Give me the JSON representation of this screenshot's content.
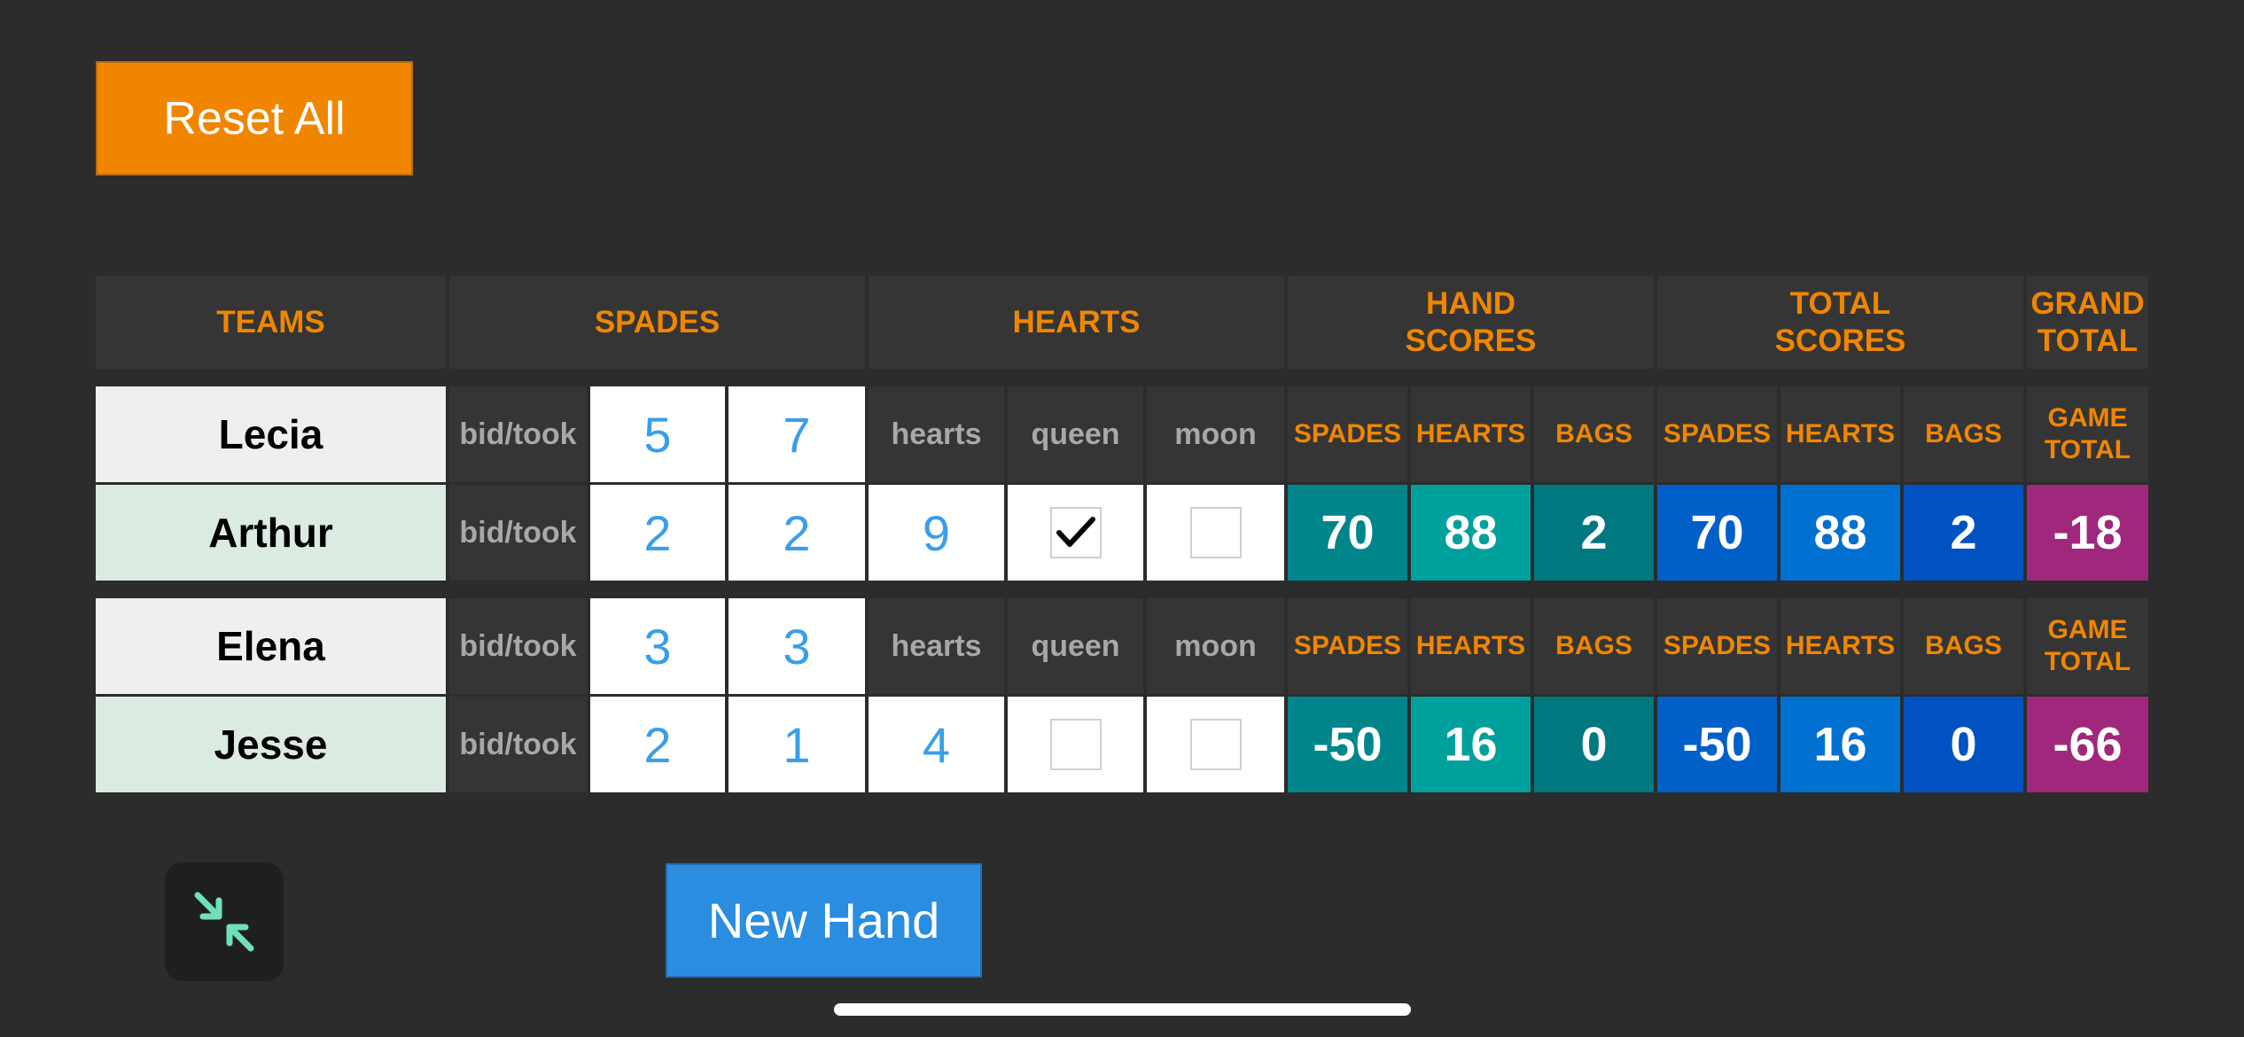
{
  "toolbar": {
    "reset_label": "Reset All"
  },
  "headers": {
    "teams": "TEAMS",
    "spades": "SPADES",
    "hearts": "HEARTS",
    "hand_scores_line1": "HAND",
    "hand_scores_line2": "SCORES",
    "total_scores_line1": "TOTAL",
    "total_scores_line2": "SCORES",
    "grand_total_line1": "GRAND",
    "grand_total_line2": "TOTAL"
  },
  "labels": {
    "bid_took": "bid/took",
    "hearts": "hearts",
    "queen": "queen",
    "moon": "moon",
    "spades": "SPADES",
    "hearts_caps": "HEARTS",
    "bags": "BAGS",
    "game_line1": "GAME",
    "game_line2": "TOTAL"
  },
  "teams": [
    {
      "player1": {
        "name": "Lecia",
        "bid": "5",
        "took": "7"
      },
      "player2": {
        "name": "Arthur",
        "bid": "2",
        "took": "2",
        "hearts": "9",
        "queen": true,
        "moon": false
      },
      "hand": {
        "spades": "70",
        "hearts": "88",
        "bags": "2"
      },
      "total": {
        "spades": "70",
        "hearts": "88",
        "bags": "2"
      },
      "game_total": "-18"
    },
    {
      "player1": {
        "name": "Elena",
        "bid": "3",
        "took": "3"
      },
      "player2": {
        "name": "Jesse",
        "bid": "2",
        "took": "1",
        "hearts": "4",
        "queen": false,
        "moon": false
      },
      "hand": {
        "spades": "-50",
        "hearts": "16",
        "bags": "0"
      },
      "total": {
        "spades": "-50",
        "hearts": "16",
        "bags": "0"
      },
      "game_total": "-66"
    }
  ],
  "footer": {
    "new_hand_label": "New Hand",
    "collapse_icon": "collapse-arrows-icon"
  },
  "colors": {
    "orange": "#f08600",
    "blue_link": "#3a9ee8",
    "teal": "#00868a",
    "blue": "#0060c8",
    "magenta": "#a0287c"
  }
}
